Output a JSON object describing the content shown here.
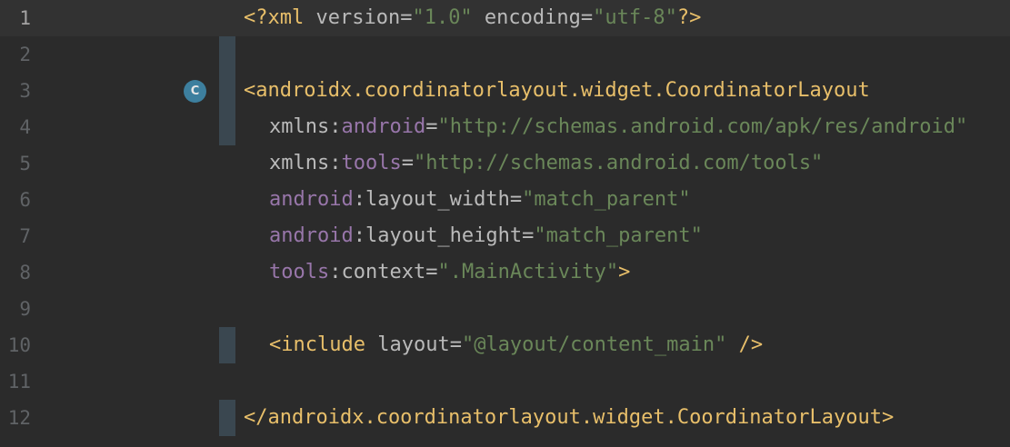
{
  "editor": {
    "gutter_icon": "class-c-icon",
    "gutter_icon_letter": "C",
    "lines": [
      {
        "n": "1"
      },
      {
        "n": "2"
      },
      {
        "n": "3"
      },
      {
        "n": "4"
      },
      {
        "n": "5"
      },
      {
        "n": "6"
      },
      {
        "n": "7"
      },
      {
        "n": "8"
      },
      {
        "n": "9"
      },
      {
        "n": "10"
      },
      {
        "n": "11"
      },
      {
        "n": "12"
      }
    ],
    "tokens": {
      "l1_open": "<?xml ",
      "l1_version": "version",
      "l1_eq1": "=",
      "l1_version_val": "\"1.0\"",
      "l1_encoding": " encoding",
      "l1_eq2": "=",
      "l1_encoding_val": "\"utf-8\"",
      "l1_close": "?>",
      "l3_tag": "<androidx.coordinatorlayout.widget.CoordinatorLayout",
      "l4_xmlns": "xmlns:",
      "l4_ns": "android",
      "l4_eq": "=",
      "l4_val": "\"http://schemas.android.com/apk/res/android\"",
      "l5_xmlns": "xmlns:",
      "l5_ns": "tools",
      "l5_eq": "=",
      "l5_val": "\"http://schemas.android.com/tools\"",
      "l6_ns": "android",
      "l6_attr": ":layout_width",
      "l6_eq": "=",
      "l6_val": "\"match_parent\"",
      "l7_ns": "android",
      "l7_attr": ":layout_height",
      "l7_eq": "=",
      "l7_val": "\"match_parent\"",
      "l8_ns": "tools",
      "l8_attr": ":context",
      "l8_eq": "=",
      "l8_val": "\".MainActivity\"",
      "l8_close": ">",
      "l10_tag": "<include ",
      "l10_attr": "layout",
      "l10_eq": "=",
      "l10_val": "\"@layout/content_main\"",
      "l10_close": " />",
      "l12_tag": "</androidx.coordinatorlayout.widget.CoordinatorLayout>"
    }
  },
  "colors": {
    "background": "#2b2b2b",
    "current_line": "#323232",
    "tag": "#e8bf6a",
    "attribute": "#bababa",
    "namespace": "#9876aa",
    "value": "#6a8759",
    "line_number": "#606366"
  }
}
